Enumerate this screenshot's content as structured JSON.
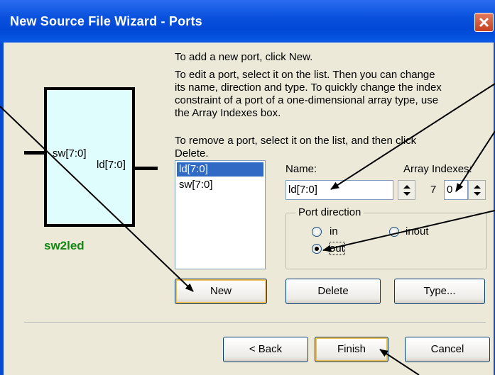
{
  "window": {
    "title": "New Source File Wizard - Ports"
  },
  "symbol": {
    "name": "sw2led",
    "input_port": "sw[7:0]",
    "output_port": "ld[7:0]"
  },
  "instructions": {
    "line1": "To add a new port, click New.",
    "para2": [
      "To edit a port, select it on the list. Then you can change",
      "its name, direction and type. To quickly change the index",
      "constraint of a port of a one-dimensional array type, use",
      "the Array Indexes box."
    ],
    "para3": [
      "To remove a port, select it on the list, and then click",
      "Delete."
    ]
  },
  "port_list": {
    "items": [
      "ld[7:0]",
      "sw[7:0]"
    ],
    "selected_index": 0
  },
  "name_field": {
    "label": "Name:",
    "value": "ld[7:0]"
  },
  "array_indexes": {
    "label": "Array Indexes:",
    "high": "7",
    "low": "0"
  },
  "port_direction": {
    "title": "Port direction",
    "options": {
      "in": "in",
      "inout": "inout",
      "out": "out"
    },
    "selected": "out"
  },
  "buttons": {
    "new": "New",
    "delete": "Delete",
    "type": "Type...",
    "back": "< Back",
    "finish": "Finish",
    "cancel": "Cancel"
  },
  "colors": {
    "titlebar": "#0a52dd",
    "symbol_fill": "#e0fdfd",
    "symbol_name": "#118811",
    "selection": "#316ac5"
  }
}
